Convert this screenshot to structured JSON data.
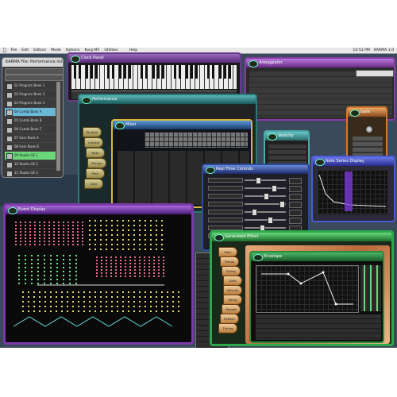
{
  "menubar": {
    "apple": "",
    "items": [
      "File",
      "Edit",
      "Editors",
      "Mode",
      "Options",
      "Korg MV",
      "Utilities",
      "",
      "Help"
    ],
    "clock": "10:51 PM",
    "app": "KARMA 1.0"
  },
  "windows": {
    "main_list": {
      "title": "KARMA File: Performance list"
    },
    "clock_panel": {
      "title": "Clock Panel"
    },
    "arpeggiator": {
      "title": "Arpeggiator"
    },
    "performance": {
      "title": "Performance"
    },
    "mixer": {
      "title": "Mixer"
    },
    "velocity": {
      "title": "Velocity"
    },
    "gate": {
      "title": "Gate"
    },
    "real_time": {
      "title": "Real Time Controls"
    },
    "note_series": {
      "title": "Note Series Display"
    },
    "event_display": {
      "title": "Event Display"
    },
    "gen_panel": {
      "title": "Generated Effect"
    },
    "envelope": {
      "title": "Envelope"
    }
  },
  "side_tabs_left": [
    "Rhythm",
    "Control",
    "Note",
    "Phrase",
    "Pitch",
    "Gate"
  ],
  "side_tabs_right": [
    "Main",
    "Tempo",
    "Swing",
    "Gate",
    "Velocity",
    "Ramp",
    "Repeat",
    "Pattern",
    "Timing",
    "Volume"
  ],
  "main_list_rows": [
    "01 Program Bank 1",
    "02 Program Bank 2",
    "03 Program Bank 3",
    "04 Combi Bank A",
    "05 Combi Bank B",
    "06 Combi Bank C",
    "07 User Bank A",
    "08 User Bank B",
    "09 Studio GE 1",
    "10 Studio GE 2",
    "11 Studio GE 3"
  ],
  "colors": {
    "purple": "#6a2e8a",
    "teal": "#1f6a6a",
    "orange": "#b56a20",
    "green": "#2a8a3a",
    "blue": "#2a4a9a",
    "gold": "#c9a845"
  }
}
